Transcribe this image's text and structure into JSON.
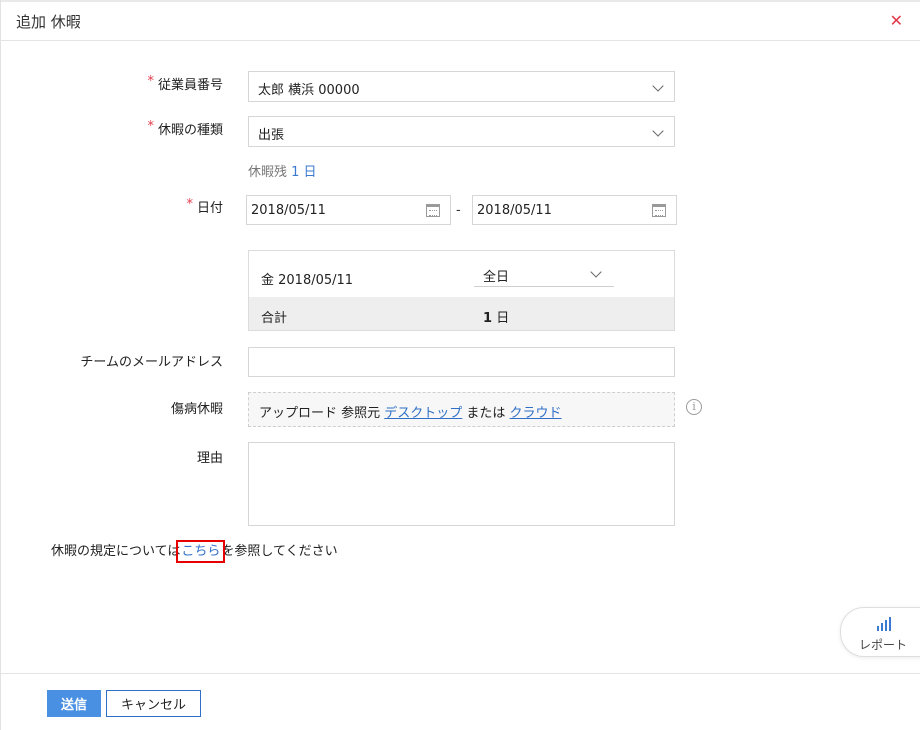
{
  "dialog": {
    "title": "追加 休暇",
    "close_glyph": "✕"
  },
  "form": {
    "required_mark": "*",
    "employee": {
      "label": "従業員番号",
      "value": "太郎 横浜 00000"
    },
    "leave_type": {
      "label": "休暇の種類",
      "value": "出張"
    },
    "balance": {
      "prefix": "休暇残",
      "value": "1 日"
    },
    "date": {
      "label": "日付",
      "from": "2018/05/11",
      "separator": "-",
      "to": "2018/05/11"
    },
    "summary": {
      "day_label": "金 2018/05/11",
      "day_type": "全日",
      "total_label": "合計",
      "total_number": "1",
      "total_unit": "日"
    },
    "team_email": {
      "label": "チームのメールアドレス",
      "value": ""
    },
    "sick_leave": {
      "label": "傷病休暇",
      "upload_prefix": "アップロード 参照元 ",
      "desktop_link": "デスクトップ",
      "or_text": " または ",
      "cloud_link": "クラウド",
      "info_glyph": "i"
    },
    "reason": {
      "label": "理由",
      "value": ""
    }
  },
  "policy": {
    "before": "休暇の規定については",
    "link": "こちら",
    "after": "を参照してください"
  },
  "report_tab": {
    "label": "レポート"
  },
  "footer": {
    "submit": "送信",
    "cancel": "キャンセル"
  },
  "colors": {
    "accent": "#4a90e2",
    "link": "#2f6fc7",
    "required": "#e2394a",
    "highlight_box": "#e60000"
  }
}
